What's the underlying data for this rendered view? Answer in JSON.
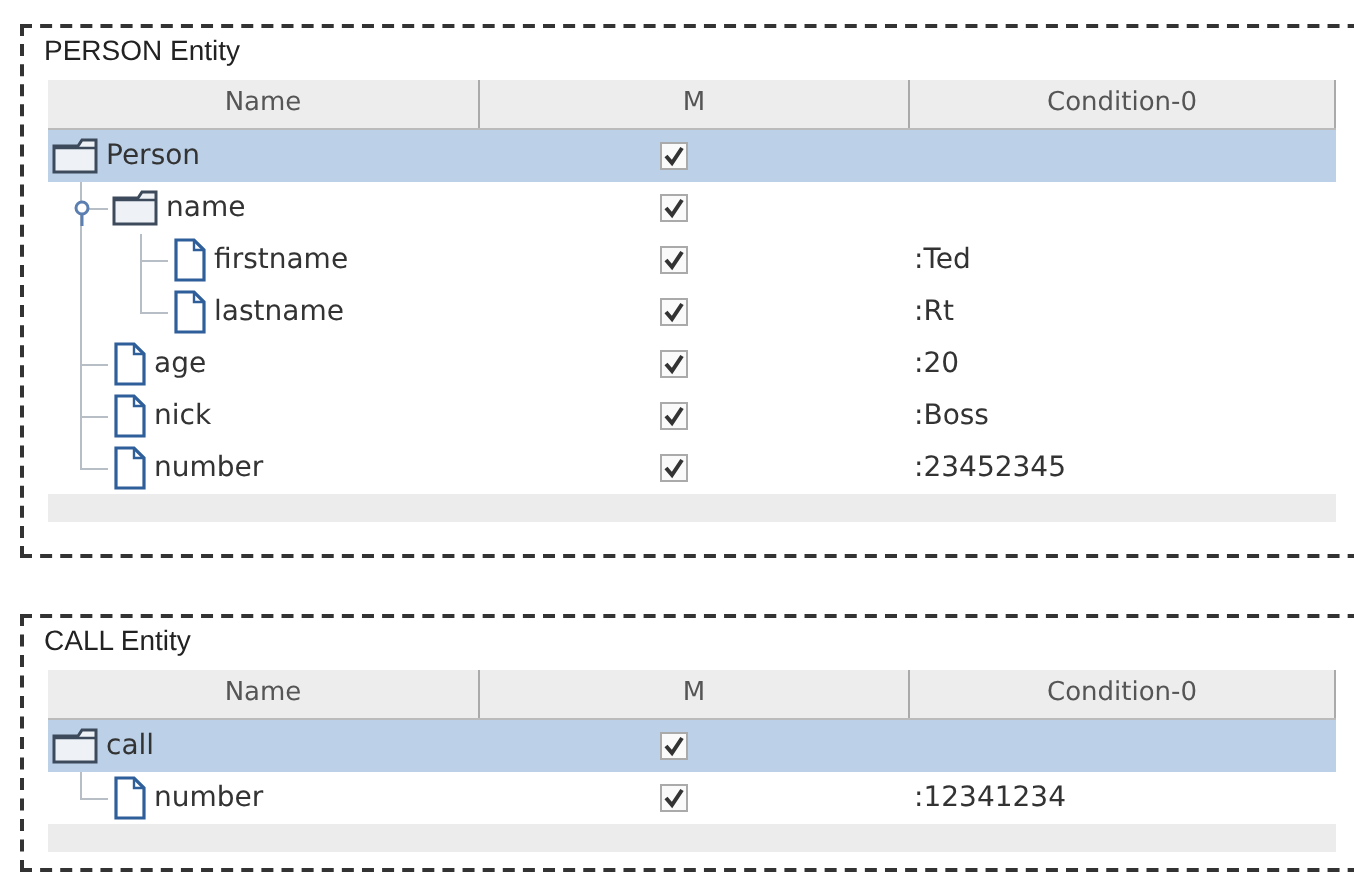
{
  "panels": [
    {
      "title": "PERSON Entity",
      "columns": [
        "Name",
        "M",
        "Condition-0"
      ],
      "rows": [
        {
          "name": "Person",
          "kind": "folder",
          "checked": true,
          "selected": true,
          "children": [
            {
              "name": "name",
              "kind": "folder",
              "checked": true,
              "selected": false,
              "expanded": true,
              "children": [
                {
                  "name": "firstname",
                  "kind": "leaf",
                  "checked": true,
                  "selected": false,
                  "condition": ":Ted"
                },
                {
                  "name": "lastname",
                  "kind": "leaf",
                  "checked": true,
                  "selected": false,
                  "condition": ":Rt"
                }
              ]
            },
            {
              "name": "age",
              "kind": "leaf",
              "checked": true,
              "selected": false,
              "condition": ":20"
            },
            {
              "name": "nick",
              "kind": "leaf",
              "checked": true,
              "selected": false,
              "condition": ":Boss"
            },
            {
              "name": "number",
              "kind": "leaf",
              "checked": true,
              "selected": false,
              "condition": ":23452345"
            }
          ]
        }
      ]
    },
    {
      "title": "CALL Entity",
      "columns": [
        "Name",
        "M",
        "Condition-0"
      ],
      "rows": [
        {
          "name": "call",
          "kind": "folder",
          "checked": true,
          "selected": true,
          "children": [
            {
              "name": "number",
              "kind": "leaf",
              "checked": true,
              "selected": false,
              "condition": ":12341234"
            }
          ]
        }
      ]
    }
  ]
}
